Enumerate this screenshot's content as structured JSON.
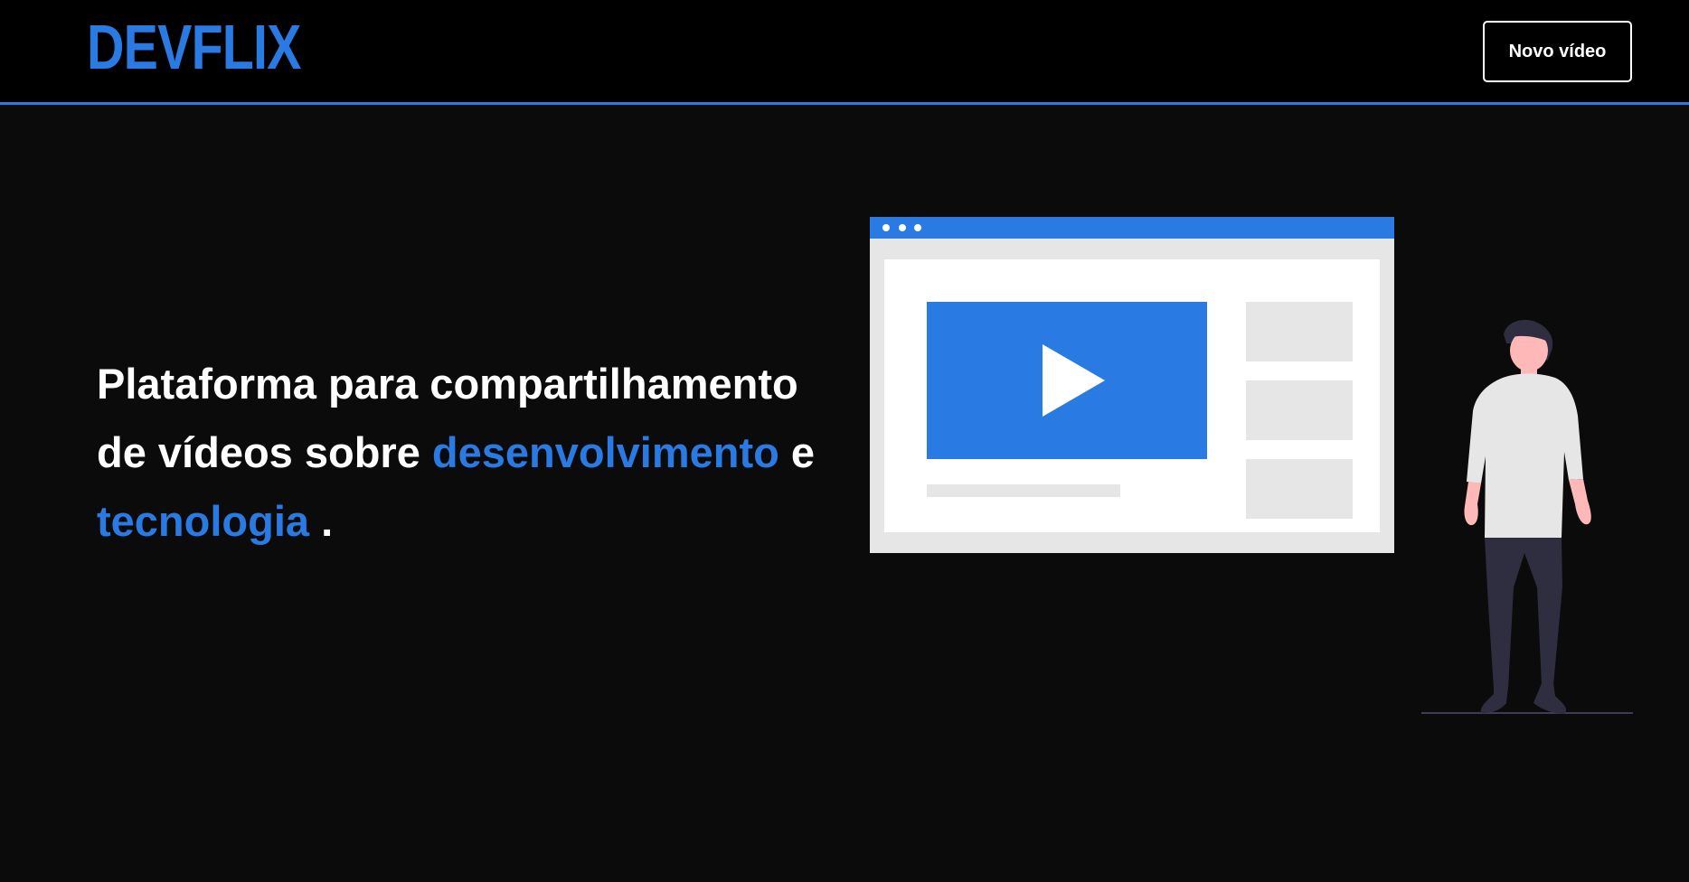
{
  "header": {
    "logo_text": "DEVFLIX",
    "new_video_label": "Novo vídeo"
  },
  "hero": {
    "line1": "Plataforma para compartilhamento",
    "line2_prefix": "de vídeos sobre ",
    "highlight1": "desenvolvimento",
    "line2_suffix": " e",
    "highlight2": "tecnologia",
    "line3_suffix": " ."
  },
  "colors": {
    "accent": "#2a7ae4",
    "background": "#0b0b0b",
    "header_background": "#000000",
    "text": "#ffffff"
  },
  "icons": {
    "illustration": "video-player-illustration",
    "person": "person-illustration"
  }
}
